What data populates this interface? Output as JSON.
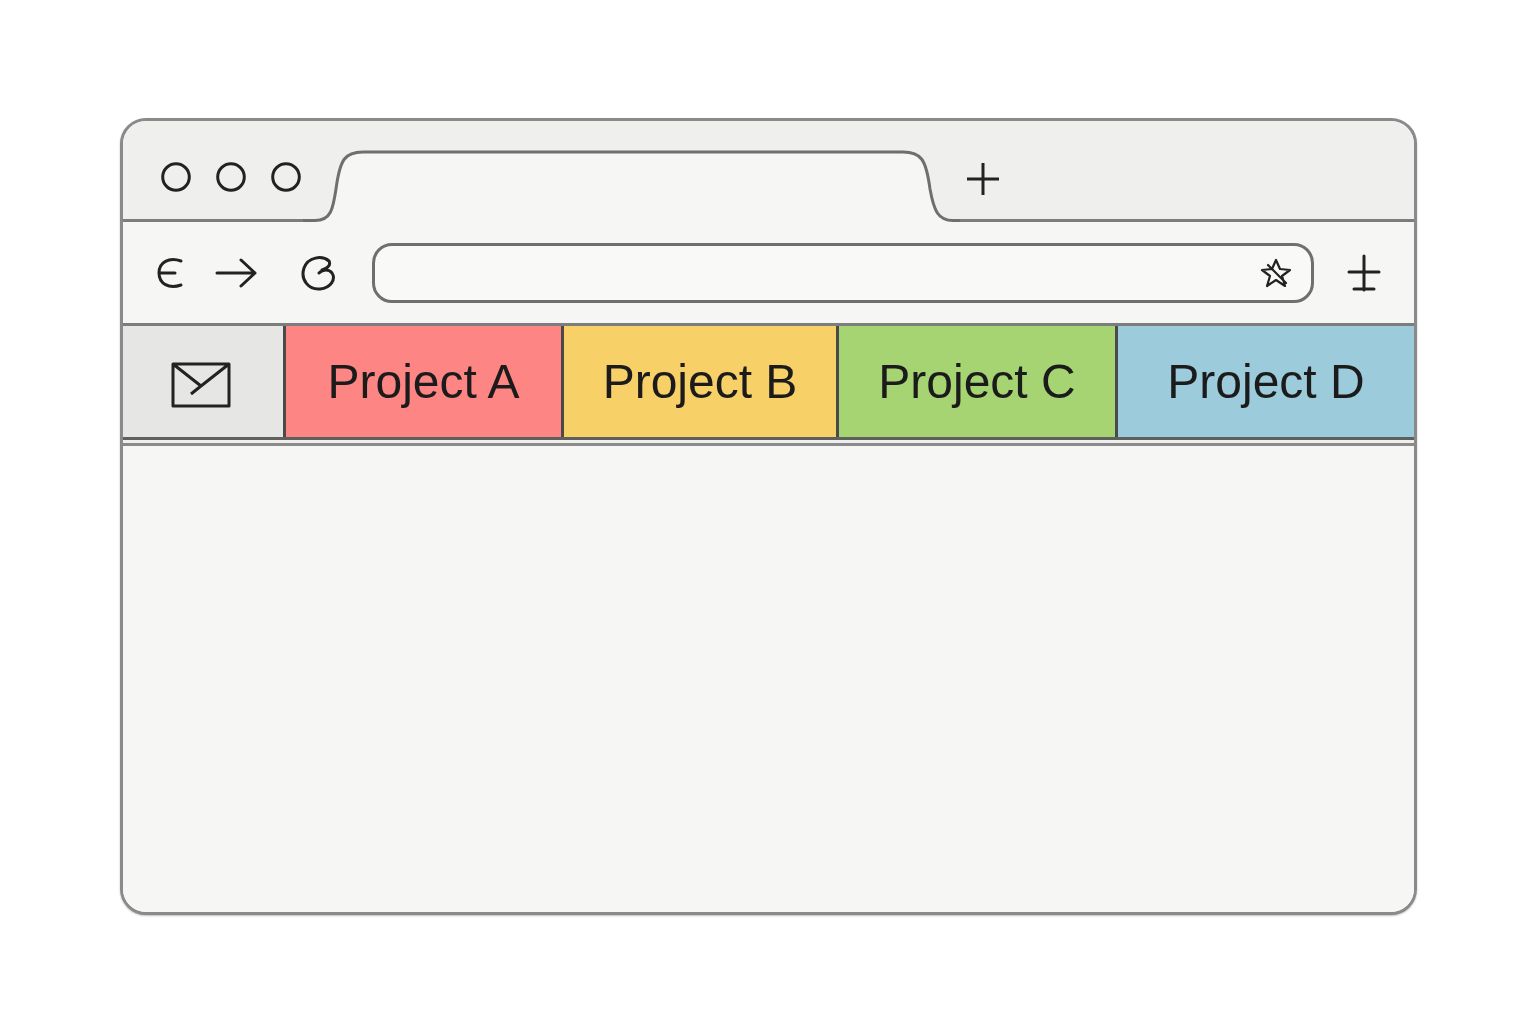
{
  "bookmarks_bar": {
    "items": [
      {
        "label": "Project A",
        "color": "#fd8583"
      },
      {
        "label": "Project B",
        "color": "#f8d068"
      },
      {
        "label": "Project C",
        "color": "#a6d472"
      },
      {
        "label": "Project D",
        "color": "#9ccbdc"
      }
    ]
  }
}
